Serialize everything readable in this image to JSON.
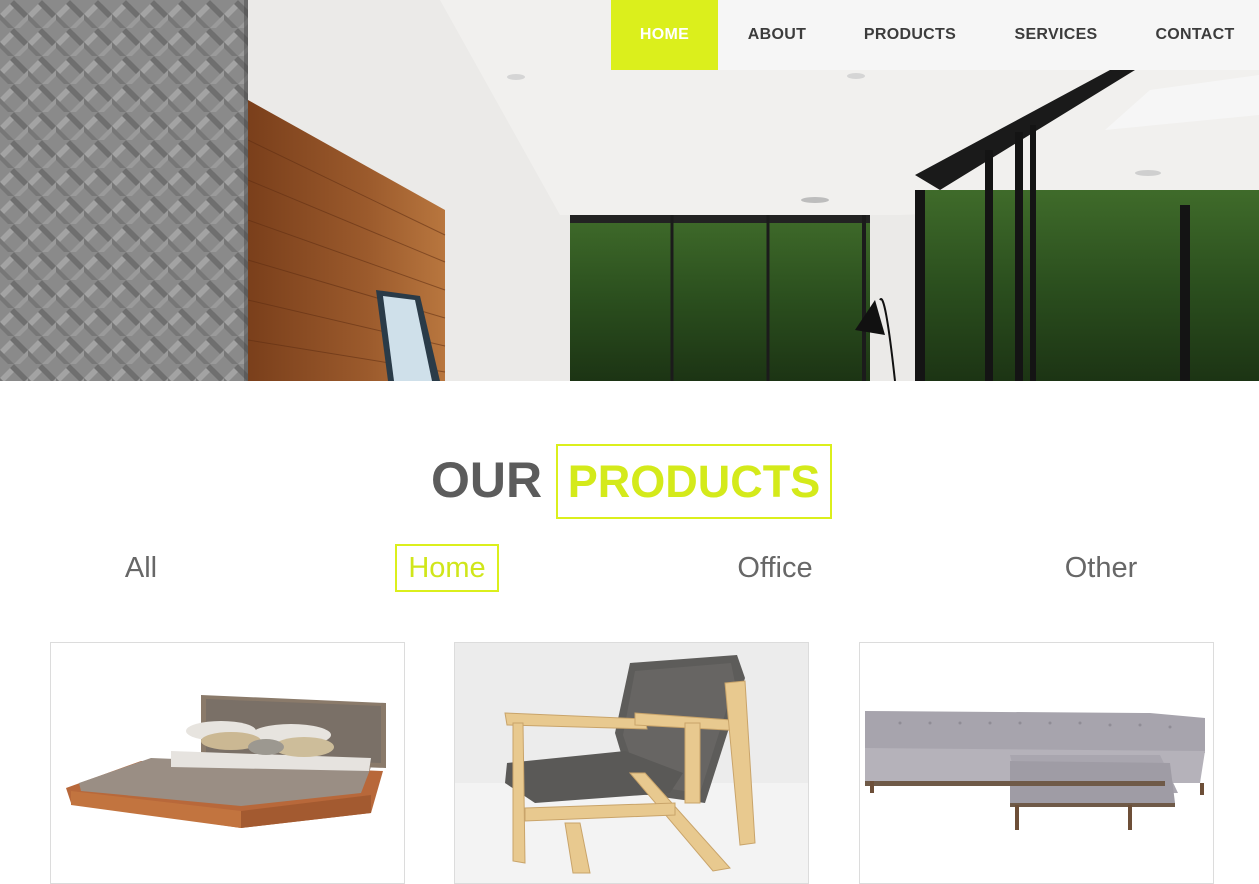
{
  "nav": {
    "items": [
      {
        "label": "HOME",
        "active": true
      },
      {
        "label": "ABOUT",
        "active": false
      },
      {
        "label": "PRODUCTS",
        "active": false
      },
      {
        "label": "SERVICES",
        "active": false
      },
      {
        "label": "CONTACT",
        "active": false
      }
    ]
  },
  "section": {
    "title_part1": "OUR",
    "title_part2": "PRODUCTS"
  },
  "filters": [
    {
      "label": "All",
      "active": false
    },
    {
      "label": "Home",
      "active": true
    },
    {
      "label": "Office",
      "active": false
    },
    {
      "label": "Other",
      "active": false
    }
  ],
  "products": [
    {
      "image": "bed-image"
    },
    {
      "image": "armchair-image"
    },
    {
      "image": "sectional-sofa-image"
    }
  ],
  "colors": {
    "accent": "#dbef1c",
    "heading": "#5c5c5c",
    "nav_text": "#3c3c3c",
    "filter_text": "#676767"
  }
}
